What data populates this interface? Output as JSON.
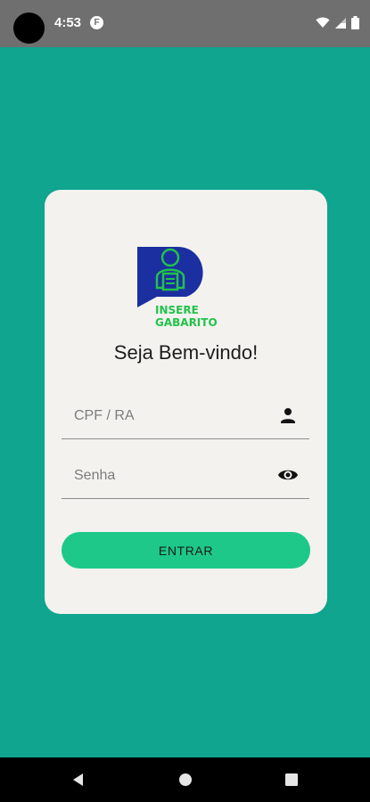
{
  "status_bar": {
    "time": "4:53",
    "app_icon": "F",
    "icons": [
      "wifi-icon",
      "signal-icon",
      "battery-icon"
    ]
  },
  "logo": {
    "line1": "INSERE",
    "line2": "GABARITO"
  },
  "login": {
    "welcome": "Seja Bem-vindo!",
    "cpf_placeholder": "CPF / RA",
    "cpf_value": "",
    "password_placeholder": "Senha",
    "password_value": "",
    "submit_label": "ENTRAR"
  },
  "colors": {
    "background": "#0fa58f",
    "card": "#f3f2ef",
    "button": "#1ec889",
    "logo_blue": "#1c2fa0",
    "logo_green": "#22c24a"
  },
  "nav_bar": {
    "buttons": [
      "back-icon",
      "home-icon",
      "recents-icon"
    ]
  }
}
